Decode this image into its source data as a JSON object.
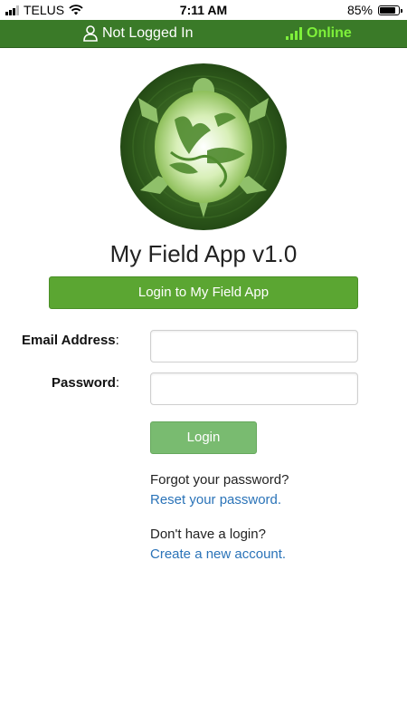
{
  "status_bar": {
    "carrier": "TELUS",
    "time": "7:11 AM",
    "battery_percent": "85%",
    "battery_level": 0.85,
    "icons": [
      "signal-icon",
      "wifi-icon",
      "battery-icon"
    ]
  },
  "top_bar": {
    "login_status": "Not Logged In",
    "network_status": "Online",
    "icons": [
      "user-icon",
      "signal-bars-icon"
    ],
    "colors": {
      "bar": "#3a7a28",
      "online": "#7ef03a"
    }
  },
  "app": {
    "logo_icon": "turtle-logo-icon",
    "title": "My Field App v1.0",
    "login_main_button": "Login to My Field App"
  },
  "form": {
    "email_label": "Email Address",
    "email_value": "",
    "password_label": "Password",
    "password_value": "",
    "colon": ":",
    "login_button": "Login"
  },
  "help": {
    "forgot_text": "Forgot your password?",
    "reset_link": "Reset your password.",
    "no_login_text": "Don't have a login?",
    "create_link": "Create a new account."
  },
  "colors": {
    "primary_button": "#5ba632",
    "login_button": "#79bb70",
    "link": "#2a73b8"
  }
}
